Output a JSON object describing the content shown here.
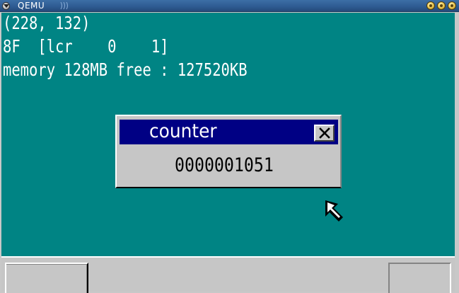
{
  "window": {
    "title": "QEMU"
  },
  "console": {
    "mouse_coords": "(228, 132)",
    "mouse_status": "8F  [lcr    0    1]",
    "memory_info": "memory 128MB free : 127520KB"
  },
  "counter_window": {
    "title": "counter",
    "value": "0000001051"
  },
  "colors": {
    "desktop": "#008484",
    "window_title_active": "#000084",
    "window_face": "#c6c6c6",
    "console_text": "#ffffff"
  },
  "icons": {
    "window_menu": "window-menu-icon",
    "titlebar_controls": [
      "minimize-icon",
      "maximize-icon",
      "close-icon"
    ],
    "counter_close": "close-icon",
    "cursor": "mouse-pointer-icon"
  }
}
